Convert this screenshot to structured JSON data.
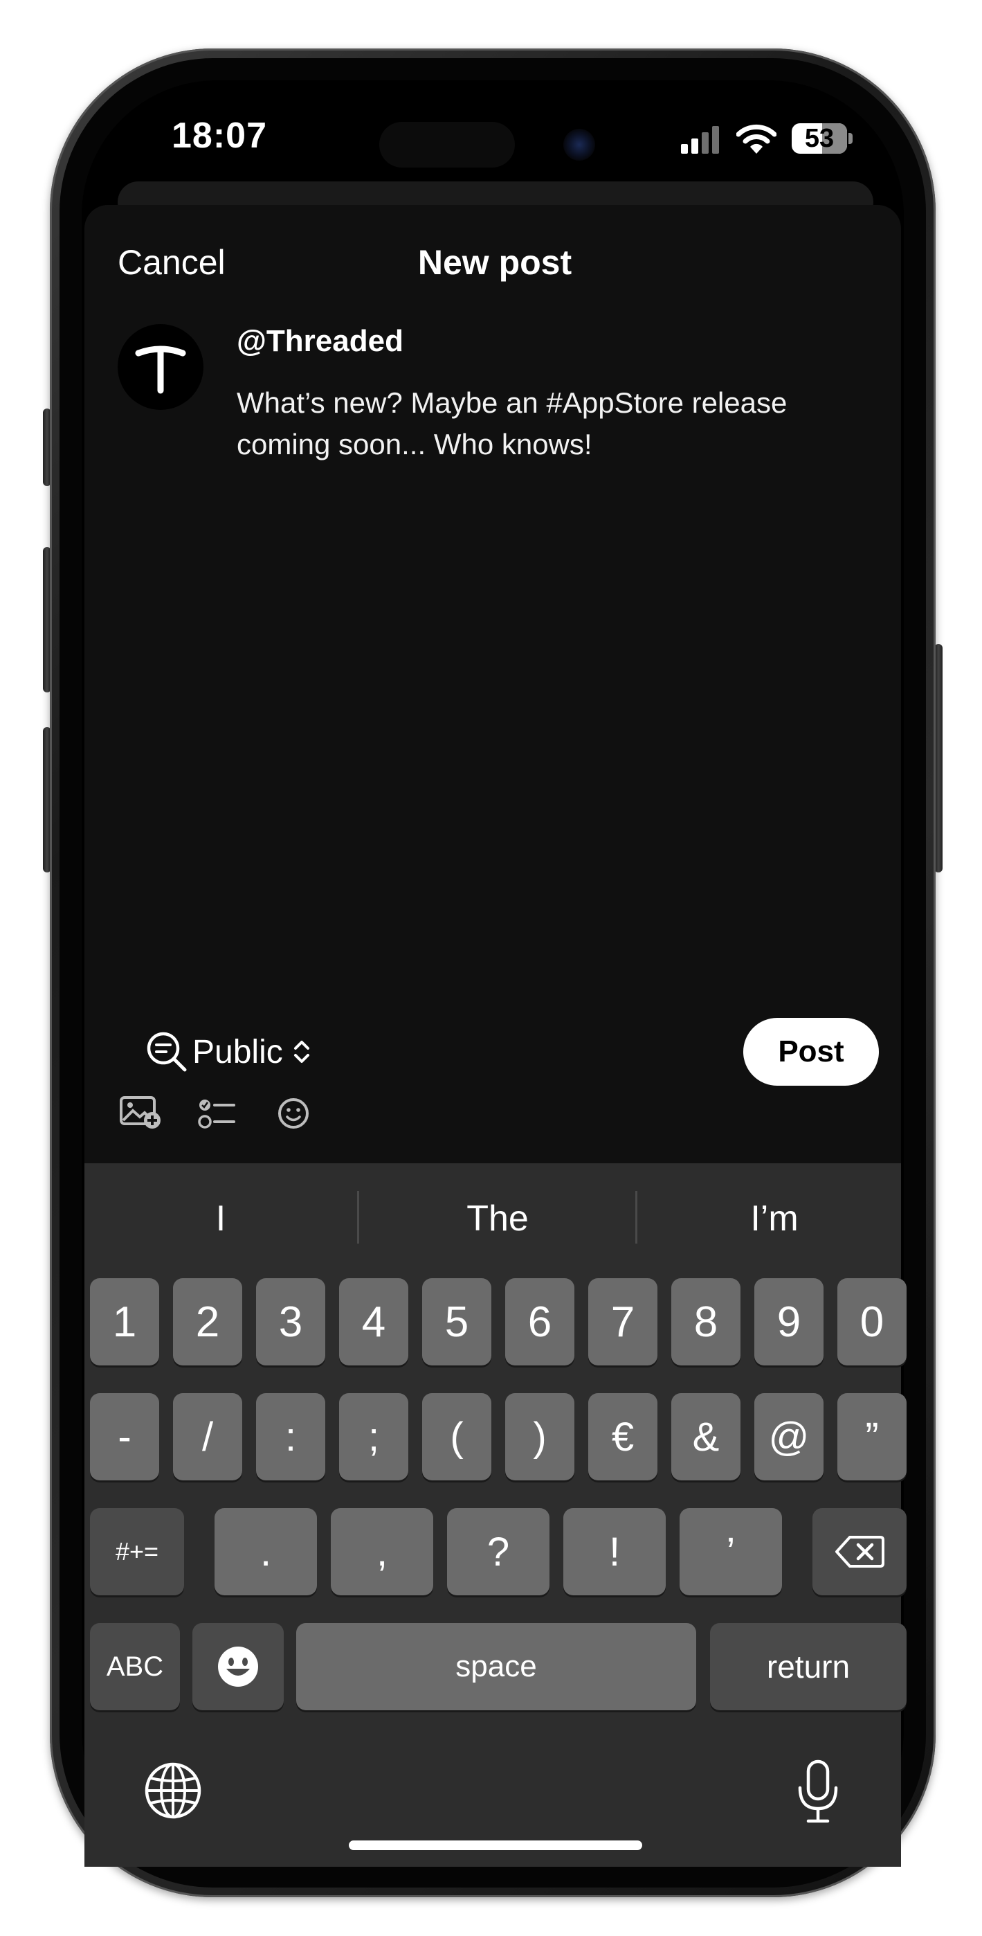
{
  "status_bar": {
    "time": "18:07",
    "battery": "53",
    "icons": [
      "cellular-signal-icon",
      "wifi-icon",
      "battery-icon"
    ]
  },
  "composer": {
    "cancel_label": "Cancel",
    "title": "New post",
    "username": "@Threaded",
    "post_text": "What’s new? Maybe an #AppStore release coming soon... Who knows!",
    "visibility_label": "Public",
    "post_button_label": "Post",
    "toolbar_icons": [
      "add-photo-icon",
      "checklist-icon",
      "emoji-icon"
    ]
  },
  "keyboard": {
    "suggestions": [
      "I",
      "The",
      "I’m"
    ],
    "row1": [
      "1",
      "2",
      "3",
      "4",
      "5",
      "6",
      "7",
      "8",
      "9",
      "0"
    ],
    "row2": [
      "-",
      "/",
      ":",
      ";",
      "(",
      ")",
      "€",
      "&",
      "@",
      "”"
    ],
    "row3": [
      "#+=",
      ".",
      ",",
      "?",
      "!",
      "’"
    ],
    "abc_label": "ABC",
    "space_label": "space",
    "return_label": "return"
  },
  "colors": {
    "sheet_background": "#101010",
    "keyboard_background": "#2d2d2d",
    "key_background": "#6b6b6b",
    "text": "#ffffff"
  }
}
